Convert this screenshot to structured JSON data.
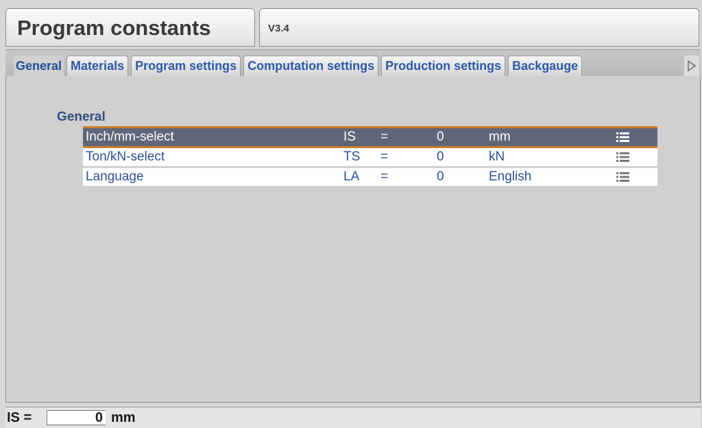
{
  "header": {
    "title": "Program constants",
    "version": "V3.4"
  },
  "tabs": [
    {
      "label": "General",
      "active": true
    },
    {
      "label": "Materials",
      "active": false
    },
    {
      "label": "Program settings",
      "active": false
    },
    {
      "label": "Computation settings",
      "active": false
    },
    {
      "label": "Production settings",
      "active": false
    },
    {
      "label": "Backgauge",
      "active": false
    }
  ],
  "tab_scroll_icon": "chevron-right-icon",
  "section": {
    "heading": "General",
    "params": [
      {
        "label": "Inch/mm-select",
        "code": "IS",
        "eq": "=",
        "value": "0",
        "unit": "mm",
        "selected": true,
        "icon": "list-icon"
      },
      {
        "label": "Ton/kN-select",
        "code": "TS",
        "eq": "=",
        "value": "0",
        "unit": "kN",
        "selected": false,
        "icon": "list-icon"
      },
      {
        "label": "Language",
        "code": "LA",
        "eq": "=",
        "value": "0",
        "unit": "English",
        "selected": false,
        "icon": "list-icon"
      }
    ]
  },
  "status": {
    "label": "IS =",
    "value": "0",
    "unit": "mm"
  },
  "colors": {
    "accent_blue": "#2d5aa8",
    "selected_row": "#5f6678",
    "selected_border": "#c97f2a",
    "background": "#d0d0d0"
  }
}
